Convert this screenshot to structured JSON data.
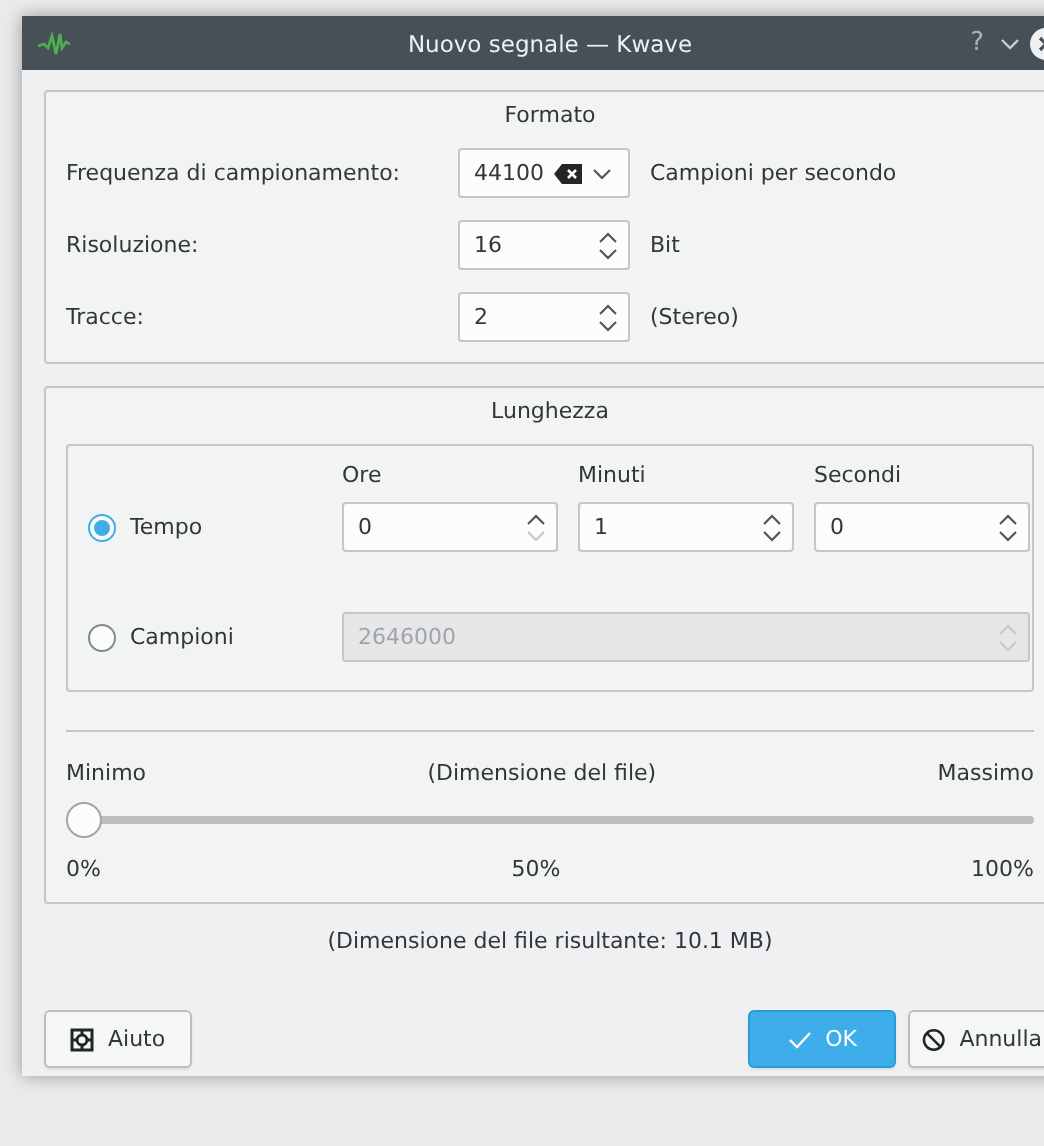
{
  "window": {
    "title": "Nuovo segnale — Kwave",
    "help_glyph": "?"
  },
  "format": {
    "title": "Formato",
    "rows": [
      {
        "kind": "combo",
        "label": "Frequenza di campionamento:",
        "value": "44100",
        "unit": "Campioni per secondo"
      },
      {
        "kind": "spin",
        "label": "Risoluzione:",
        "value": "16",
        "unit": "Bit"
      },
      {
        "kind": "spin",
        "label": "Tracce:",
        "value": "2",
        "unit": "(Stereo)"
      }
    ]
  },
  "length": {
    "title": "Lunghezza",
    "columns": [
      "Ore",
      "Minuti",
      "Secondi"
    ],
    "modes": [
      {
        "kind": "time",
        "label": "Tempo",
        "selected": true,
        "fields": [
          {
            "value": "0",
            "at_min": true
          },
          {
            "value": "1",
            "at_min": false
          },
          {
            "value": "0",
            "at_min": false
          }
        ]
      },
      {
        "kind": "samples",
        "label": "Campioni",
        "selected": false,
        "value": "2646000",
        "disabled": true
      }
    ],
    "slider": {
      "min_label": "Minimo",
      "title": "(Dimensione del file)",
      "max_label": "Massimo",
      "level": 0,
      "ticks": [
        "0%",
        "50%",
        "100%"
      ]
    }
  },
  "result": "(Dimensione del file risultante: 10.1 MB)",
  "buttons": [
    {
      "kind": "help",
      "label": "Aiuto",
      "default": false
    },
    {
      "kind": "ok",
      "label": "OK",
      "default": true
    },
    {
      "kind": "cancel",
      "label": "Annulla",
      "default": false
    }
  ]
}
